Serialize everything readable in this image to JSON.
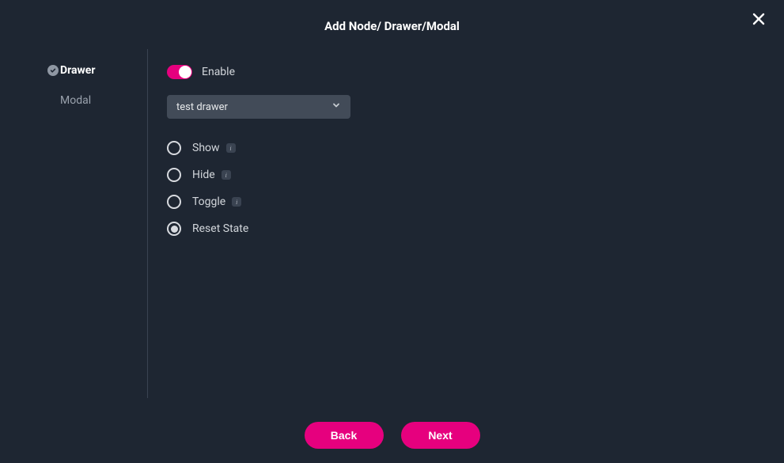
{
  "header": {
    "title": "Add Node/ Drawer/Modal"
  },
  "sidebar": {
    "items": [
      {
        "label": "Drawer",
        "active": true,
        "checked": true
      },
      {
        "label": "Modal",
        "active": false,
        "checked": false
      }
    ]
  },
  "content": {
    "enable": {
      "label": "Enable",
      "on": true
    },
    "select": {
      "value": "test drawer"
    },
    "radios": [
      {
        "label": "Show",
        "selected": false,
        "info": true
      },
      {
        "label": "Hide",
        "selected": false,
        "info": true
      },
      {
        "label": "Toggle",
        "selected": false,
        "info": true
      },
      {
        "label": "Reset State",
        "selected": true,
        "info": false
      }
    ]
  },
  "footer": {
    "back": "Back",
    "next": "Next"
  },
  "colors": {
    "accent": "#e6007e",
    "bg": "#1e2632",
    "panel": "#424b58"
  }
}
